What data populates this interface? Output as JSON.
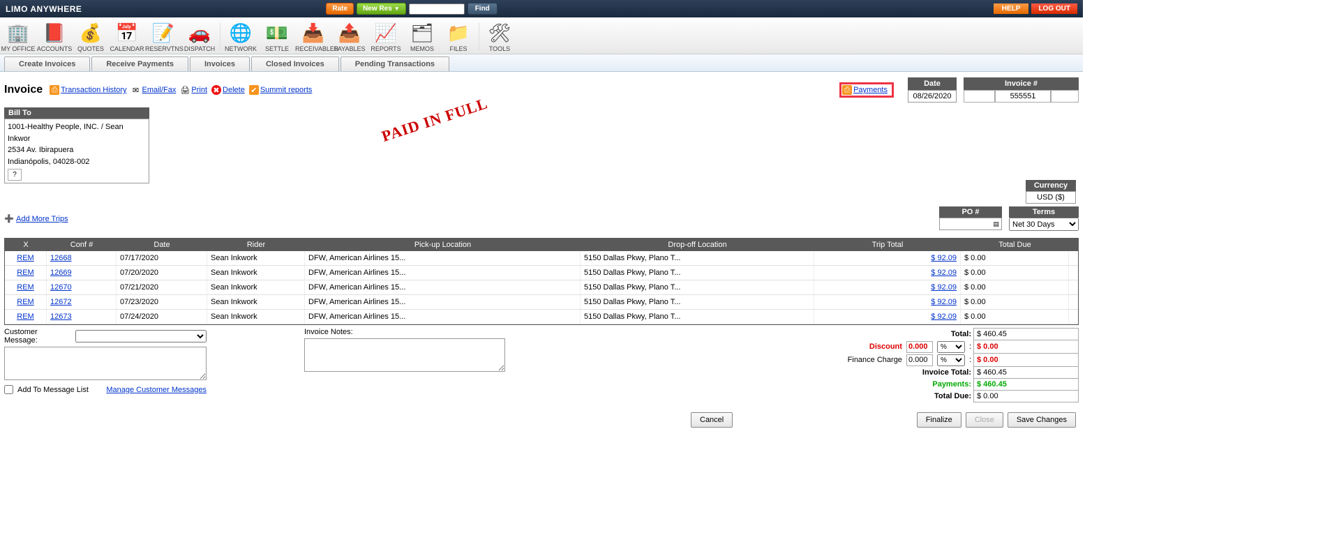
{
  "top": {
    "logo": "LIMO ANYWHERE",
    "rate": "Rate",
    "newres": "New Res",
    "find": "Find",
    "help": "HELP",
    "logout": "LOG OUT"
  },
  "toolbar": [
    {
      "label": "MY OFFICE",
      "icon": "🏢"
    },
    {
      "label": "ACCOUNTS",
      "icon": "📕"
    },
    {
      "label": "QUOTES",
      "icon": "💰"
    },
    {
      "label": "CALENDAR",
      "icon": "📅"
    },
    {
      "label": "RESERVTNS",
      "icon": "📝"
    },
    {
      "label": "DISPATCH",
      "icon": "🚗"
    },
    {
      "label": "NETWORK",
      "icon": "🌐"
    },
    {
      "label": "SETTLE",
      "icon": "💵"
    },
    {
      "label": "RECEIVABLES",
      "icon": "📥"
    },
    {
      "label": "PAYABLES",
      "icon": "📤"
    },
    {
      "label": "REPORTS",
      "icon": "📈"
    },
    {
      "label": "MEMOS",
      "icon": "🗂"
    },
    {
      "label": "FILES",
      "icon": "📁"
    },
    {
      "label": "TOOLS",
      "icon": "🛠"
    }
  ],
  "subtabs": [
    "Create Invoices",
    "Receive Payments",
    "Invoices",
    "Closed Invoices",
    "Pending Transactions"
  ],
  "actions": {
    "title": "Invoice",
    "history": "Transaction History",
    "email": "Email/Fax",
    "print": "Print",
    "delete": "Delete",
    "summit": "Summit reports",
    "payments": "Payments"
  },
  "head": {
    "date_label": "Date",
    "date_value": "08/26/2020",
    "inv_label": "Invoice #",
    "inv_value": "555551"
  },
  "billto": {
    "label": "Bill To",
    "line1": "1001-Healthy People, INC. / Sean Inkwor",
    "line2": "2534 Av. Ibirapuera",
    "line3": "Indianópolis,  04028-002",
    "q": "?"
  },
  "stamp": "PAID IN FULL",
  "currency": {
    "label": "Currency",
    "value": "USD ($)"
  },
  "addtrips": "Add More Trips",
  "po_label": "PO #",
  "terms_label": "Terms",
  "terms_value": "Net 30 Days",
  "columns": {
    "x": "X",
    "conf": "Conf #",
    "date": "Date",
    "rider": "Rider",
    "pick": "Pick-up Location",
    "drop": "Drop-off Location",
    "trip": "Trip Total",
    "due": "Total Due"
  },
  "rows": [
    {
      "x": "REM",
      "conf": "12668",
      "date": "07/17/2020",
      "rider": "Sean Inkwork",
      "pick": "DFW, American Airlines 15...",
      "drop": "5150 Dallas Pkwy, Plano T...",
      "trip": "$ 92.09",
      "due": "$ 0.00"
    },
    {
      "x": "REM",
      "conf": "12669",
      "date": "07/20/2020",
      "rider": "Sean Inkwork",
      "pick": "DFW, American Airlines 15...",
      "drop": "5150 Dallas Pkwy, Plano T...",
      "trip": "$ 92.09",
      "due": "$ 0.00"
    },
    {
      "x": "REM",
      "conf": "12670",
      "date": "07/21/2020",
      "rider": "Sean Inkwork",
      "pick": "DFW, American Airlines 15...",
      "drop": "5150 Dallas Pkwy, Plano T...",
      "trip": "$ 92.09",
      "due": "$ 0.00"
    },
    {
      "x": "REM",
      "conf": "12672",
      "date": "07/23/2020",
      "rider": "Sean Inkwork",
      "pick": "DFW, American Airlines 15...",
      "drop": "5150 Dallas Pkwy, Plano T...",
      "trip": "$ 92.09",
      "due": "$ 0.00"
    },
    {
      "x": "REM",
      "conf": "12673",
      "date": "07/24/2020",
      "rider": "Sean Inkwork",
      "pick": "DFW, American Airlines 15...",
      "drop": "5150 Dallas Pkwy, Plano T...",
      "trip": "$ 92.09",
      "due": "$ 0.00"
    }
  ],
  "footer": {
    "cust_msg_label": "Customer Message:",
    "add_to_list": "Add To Message List",
    "manage": "Manage Customer Messages",
    "inv_notes": "Invoice Notes:"
  },
  "totals": {
    "total_label": "Total:",
    "total": "$ 460.45",
    "discount_label": "Discount",
    "discount_num": "0.000",
    "discount_type": "%",
    "discount_val": "$ 0.00",
    "finance_label": "Finance Charge",
    "finance_num": "0.000",
    "finance_type": "%",
    "finance_val": "$ 0.00",
    "inv_total_label": "Invoice Total:",
    "inv_total": "$ 460.45",
    "payments_label": "Payments:",
    "payments": "$ 460.45",
    "due_label": "Total Due:",
    "due": "$ 0.00"
  },
  "buttons": {
    "cancel": "Cancel",
    "finalize": "Finalize",
    "close": "Close",
    "save": "Save Changes"
  }
}
